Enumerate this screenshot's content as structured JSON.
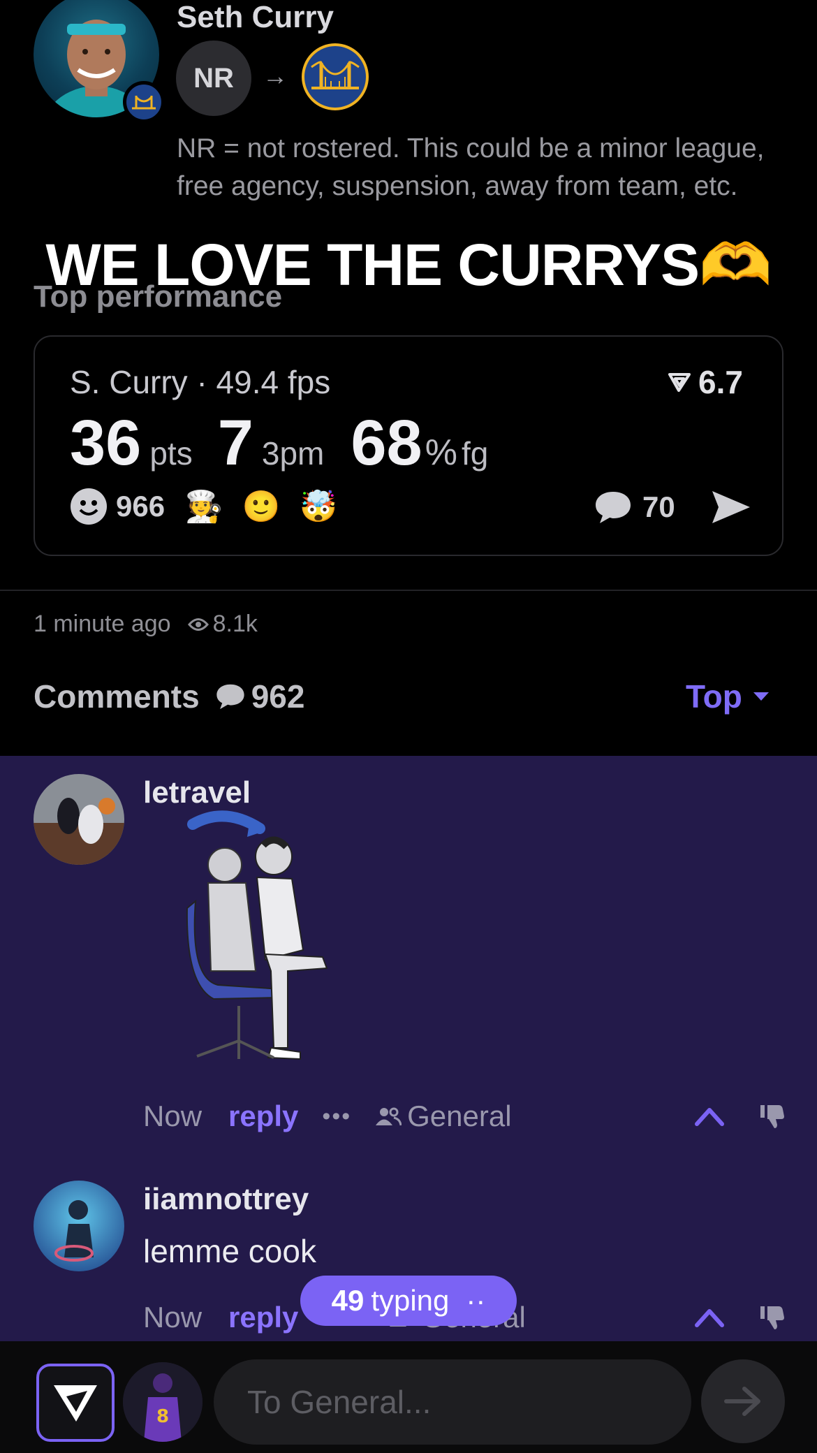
{
  "transaction": {
    "player_name": "Seth Curry",
    "from_label": "NR",
    "to_team_icon": "warriors-logo",
    "note": "NR = not rostered. This could be a minor league, free agency, suspension, away from team, etc."
  },
  "overlay_caption": "WE LOVE THE CURRYS🫶",
  "top_performance": {
    "heading": "Top performance",
    "player_line": "S. Curry · 49.4 fps",
    "score": "6.7",
    "pts_value": "36",
    "pts_label": "pts",
    "threes_value": "7",
    "threes_label": "3pm",
    "fg_value": "68",
    "fg_pct": "%",
    "fg_label": "fg",
    "reaction_count": "966",
    "reaction_emojis": [
      "🧑‍🍳",
      "🙂",
      "🤯"
    ],
    "comment_count": "70"
  },
  "meta": {
    "time": "1 minute ago",
    "views": "8.1k"
  },
  "comments_header": {
    "title": "Comments",
    "count": "962",
    "sort": "Top"
  },
  "comments": [
    {
      "username": "letravel",
      "time": "Now",
      "reply": "reply",
      "more": "•••",
      "channel": "General"
    },
    {
      "username": "iiamnottrey",
      "text": "lemme cook",
      "time": "Now",
      "reply": "reply",
      "channel": "General"
    }
  ],
  "typing": {
    "count": "49",
    "label": "typing",
    "dots": "··"
  },
  "composer": {
    "placeholder": "To General..."
  },
  "colors": {
    "accent": "#7b63f4",
    "comments_bg": "#231a4a"
  }
}
